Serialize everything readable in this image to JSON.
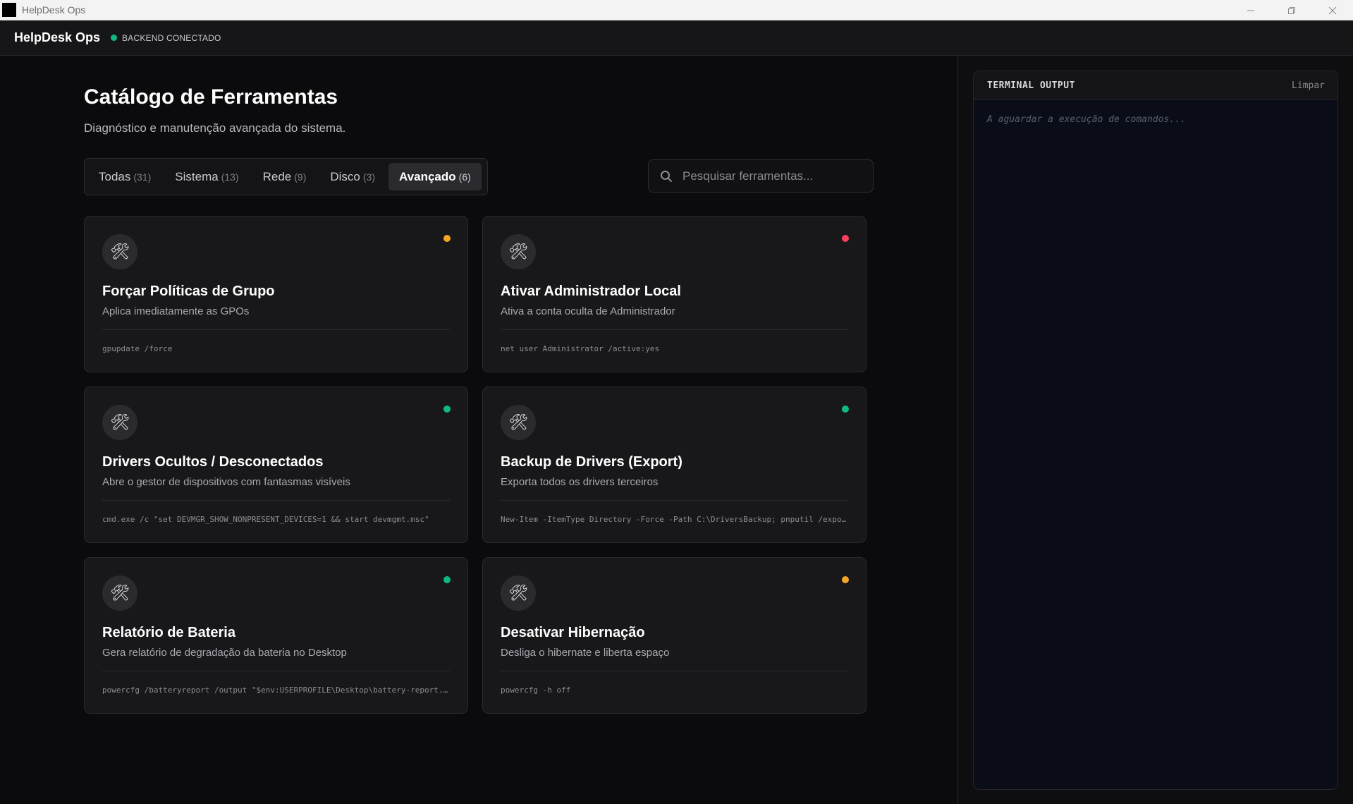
{
  "window": {
    "title": "HelpDesk Ops",
    "controls": [
      "minimize",
      "restore",
      "close"
    ]
  },
  "appbar": {
    "brand": "HelpDesk Ops",
    "status_text": "BACKEND CONECTADO",
    "status_color": "#10b981"
  },
  "main": {
    "title": "Catálogo de Ferramentas",
    "subtitle": "Diagnóstico e manutenção avançada do sistema.",
    "tabs": [
      {
        "label": "Todas",
        "count": "(31)",
        "active": false
      },
      {
        "label": "Sistema",
        "count": "(13)",
        "active": false
      },
      {
        "label": "Rede",
        "count": "(9)",
        "active": false
      },
      {
        "label": "Disco",
        "count": "(3)",
        "active": false
      },
      {
        "label": "Avançado",
        "count": "(6)",
        "active": true
      }
    ],
    "search": {
      "placeholder": "Pesquisar ferramentas...",
      "value": ""
    },
    "cards": [
      {
        "title": "Forçar Políticas de Grupo",
        "description": "Aplica imediatamente as GPOs",
        "command": "gpupdate /force",
        "status_color": "#f5a524",
        "icon": "tools-icon"
      },
      {
        "title": "Ativar Administrador Local",
        "description": "Ativa a conta oculta de Administrador",
        "command": "net user Administrator /active:yes",
        "status_color": "#f43f5e",
        "icon": "tools-icon"
      },
      {
        "title": "Drivers Ocultos / Desconectados",
        "description": "Abre o gestor de dispositivos com fantasmas visíveis",
        "command": "cmd.exe /c \"set DEVMGR_SHOW_NONPRESENT_DEVICES=1 && start devmgmt.msc\"",
        "status_color": "#10b981",
        "icon": "tools-icon"
      },
      {
        "title": "Backup de Drivers (Export)",
        "description": "Exporta todos os drivers terceiros",
        "command": "New-Item -ItemType Directory -Force -Path C:\\DriversBackup; pnputil /export-driver * C:\\DriversBackup",
        "status_color": "#10b981",
        "icon": "tools-icon"
      },
      {
        "title": "Relatório de Bateria",
        "description": "Gera relatório de degradação da bateria no Desktop",
        "command": "powercfg /batteryreport /output \"$env:USERPROFILE\\Desktop\\battery-report.html\"",
        "status_color": "#10b981",
        "icon": "tools-icon"
      },
      {
        "title": "Desativar Hibernação",
        "description": "Desliga o hibernate e liberta espaço",
        "command": "powercfg -h off",
        "status_color": "#f5a524",
        "icon": "tools-icon"
      }
    ]
  },
  "terminal": {
    "title": "TERMINAL OUTPUT",
    "clear_label": "Limpar",
    "placeholder": "A aguardar a execução de comandos..."
  }
}
